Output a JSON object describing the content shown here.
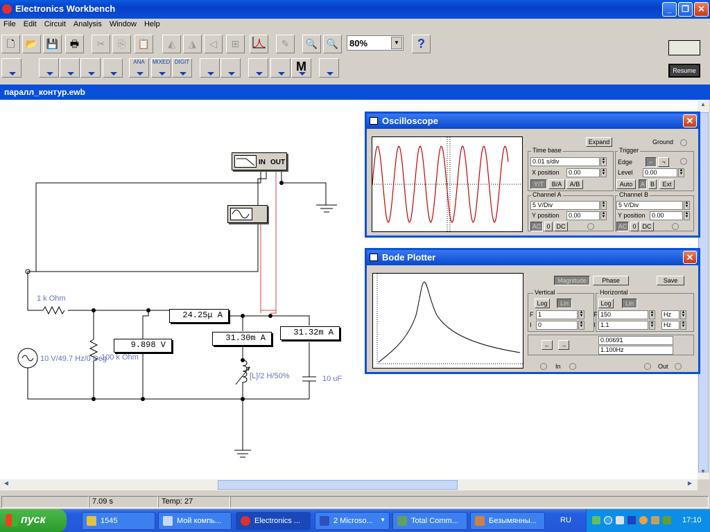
{
  "app": {
    "title": "Electronics Workbench"
  },
  "menu": [
    "File",
    "Edit",
    "Circuit",
    "Analysis",
    "Window",
    "Help"
  ],
  "toolbar": {
    "zoom": "80%",
    "help": "?",
    "resume": "Resume"
  },
  "parts_bins": [
    "ANA",
    "MIXED",
    "DIGIT"
  ],
  "document": {
    "title": "паралл_контур.ewb"
  },
  "circuit": {
    "resistor1": "1 k Ohm",
    "resistor2": "100 k Ohm",
    "source": "10 V/49.7 Hz/0 Deg",
    "inductor": "[L]/2 H/50%",
    "capacitor": "10 uF",
    "ammeter1": "24.25μ A",
    "ammeter2": "31.30m A",
    "ammeter3": "31.32m A",
    "voltmeter": "9.898  V",
    "bode_ports": {
      "in": "IN",
      "out": "OUT"
    }
  },
  "oscilloscope": {
    "title": "Oscilloscope",
    "expand": "Expand",
    "ground": "Ground",
    "timebase": {
      "label": "Time base",
      "value": "0.01 s/div",
      "xpos_label": "X position",
      "xpos": "0.00",
      "modes": [
        "Y/T",
        "B/A",
        "A/B"
      ]
    },
    "trigger": {
      "label": "Trigger",
      "edge": "Edge",
      "level_label": "Level",
      "level": "0.00",
      "sources": [
        "Auto",
        "A",
        "B",
        "Ext"
      ]
    },
    "channel_a": {
      "label": "Channel A",
      "value": "5  V/Div",
      "ypos_label": "Y position",
      "ypos": "0.00",
      "coupling": [
        "AC",
        "0",
        "DC"
      ]
    },
    "channel_b": {
      "label": "Channel B",
      "value": "5  V/Div",
      "ypos_label": "Y position",
      "ypos": "0.00",
      "coupling": [
        "AC",
        "0",
        "DC"
      ]
    }
  },
  "bode": {
    "title": "Bode Plotter",
    "magnitude": "Magnitude",
    "phase": "Phase",
    "save": "Save",
    "vertical": {
      "label": "Vertical",
      "log": "Log",
      "lin": "Lin",
      "f_label": "F",
      "i_label": "I",
      "f": "1",
      "i": "0"
    },
    "horizontal": {
      "label": "Horizontal",
      "log": "Log",
      "lin": "Lin",
      "f_label": "F",
      "i_label": "I",
      "f": "150",
      "i": "1.1",
      "f_unit": "Hz",
      "i_unit": "Hz"
    },
    "readout1": "0.00691",
    "readout2": "1.100Hz",
    "in": "In",
    "out": "Out"
  },
  "status": {
    "time": "7.09 s",
    "temp": "Temp:  27"
  },
  "taskbar": {
    "start": "пуск",
    "tasks": [
      "1545",
      "Мой компь...",
      "Electronics ...",
      "2 Microso...",
      "Total Comm...",
      "Безымянны..."
    ],
    "lang": "RU",
    "clock": "17:10"
  },
  "colors": {
    "accent": "#0a4fd8",
    "label": "#6670c8",
    "trace": "#c00000",
    "wire_red": "#e04040"
  }
}
